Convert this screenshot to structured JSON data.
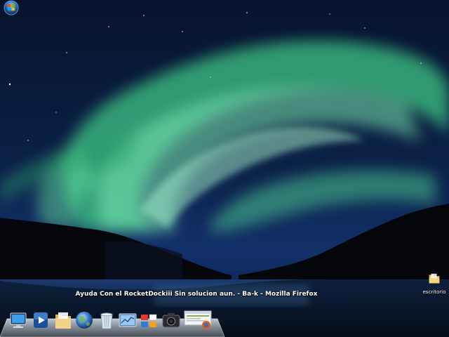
{
  "desktop": {
    "icons": [
      {
        "label": "escritorio",
        "icon": "folder-icon"
      }
    ]
  },
  "taskbar": {
    "start_icon": "windows-orb-icon"
  },
  "dock": {
    "tooltip": "Ayuda Con el RocketDockiii Sin solucion aun. - Ba-k - Mozilla Firefox",
    "items": [
      {
        "icon": "computer-icon"
      },
      {
        "icon": "media-player-icon"
      },
      {
        "icon": "documents-folder-icon"
      },
      {
        "icon": "globe-icon"
      },
      {
        "icon": "recycle-bin-icon"
      },
      {
        "icon": "control-panel-icon"
      },
      {
        "icon": "apps-stack-icon"
      },
      {
        "icon": "camera-icon"
      },
      {
        "icon": "firefox-window-icon"
      }
    ]
  }
}
